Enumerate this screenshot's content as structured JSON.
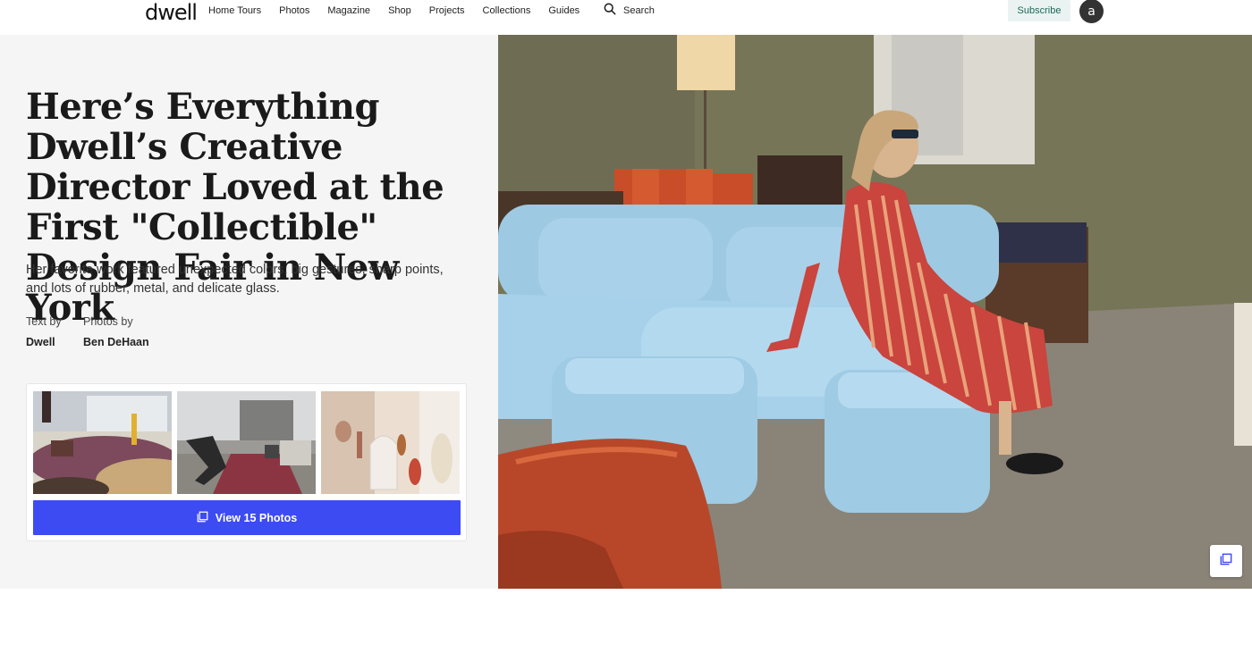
{
  "header": {
    "logo": "dwell",
    "nav": [
      "Home Tours",
      "Photos",
      "Magazine",
      "Shop",
      "Projects",
      "Collections",
      "Guides"
    ],
    "search_label": "Search",
    "subscribe_label": "Subscribe",
    "avatar_letter": "a"
  },
  "article": {
    "title": "Here’s Everything Dwell’s Creative Director Loved at the First \"Collectible\" Design Fair in New York",
    "dek": "Her favorite work featured unexpected colors, big gestures, sharp points, and lots of rubber, metal, and delicate glass.",
    "text_by_label": "Text by",
    "text_by": "Dwell",
    "photos_by_label": "Photos by",
    "photos_by": "Ben DeHaan"
  },
  "gallery": {
    "view_label": "View 15 Photos",
    "icon": "gallery-icon"
  },
  "colors": {
    "accent": "#3d4bf2",
    "subscribe_bg": "#eaf3f1",
    "subscribe_text": "#1b6b59",
    "panel_bg": "#f5f5f5"
  }
}
